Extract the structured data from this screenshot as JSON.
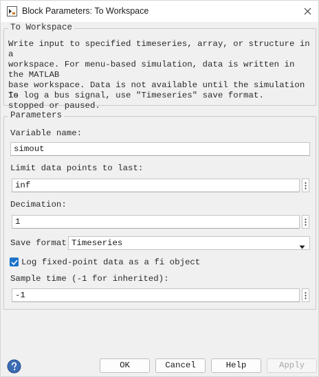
{
  "window": {
    "title": "Block Parameters: To Workspace"
  },
  "block_group": {
    "legend": "To Workspace",
    "description": "Write input to specified timeseries, array, or structure in a\nworkspace. For menu-based simulation, data is written in the MATLAB\nbase workspace. Data is not available until the simulation is\nstopped or paused.",
    "note": "To log a bus signal, use \"Timeseries\" save format."
  },
  "parameters": {
    "legend": "Parameters",
    "variable_name_label": "Variable name:",
    "variable_name_value": "simout",
    "limit_label": "Limit data points to last:",
    "limit_value": "inf",
    "decimation_label": "Decimation:",
    "decimation_value": "1",
    "save_format_label": "Save format:",
    "save_format_value": "Timeseries",
    "log_fixed_point_label": "Log fixed-point data as a fi object",
    "log_fixed_point_checked": true,
    "sample_time_label": "Sample time (-1 for inherited):",
    "sample_time_value": "-1"
  },
  "buttons": {
    "ok": "OK",
    "cancel": "Cancel",
    "help": "Help",
    "apply": "Apply"
  },
  "colors": {
    "accent": "#1a73c9",
    "help_icon": "#3b6cb4"
  },
  "icons": {
    "app": "simulink-block-icon",
    "close": "close-icon",
    "help": "help-question-icon",
    "more": "vertical-ellipsis-icon",
    "dropdown": "caret-down-icon"
  }
}
